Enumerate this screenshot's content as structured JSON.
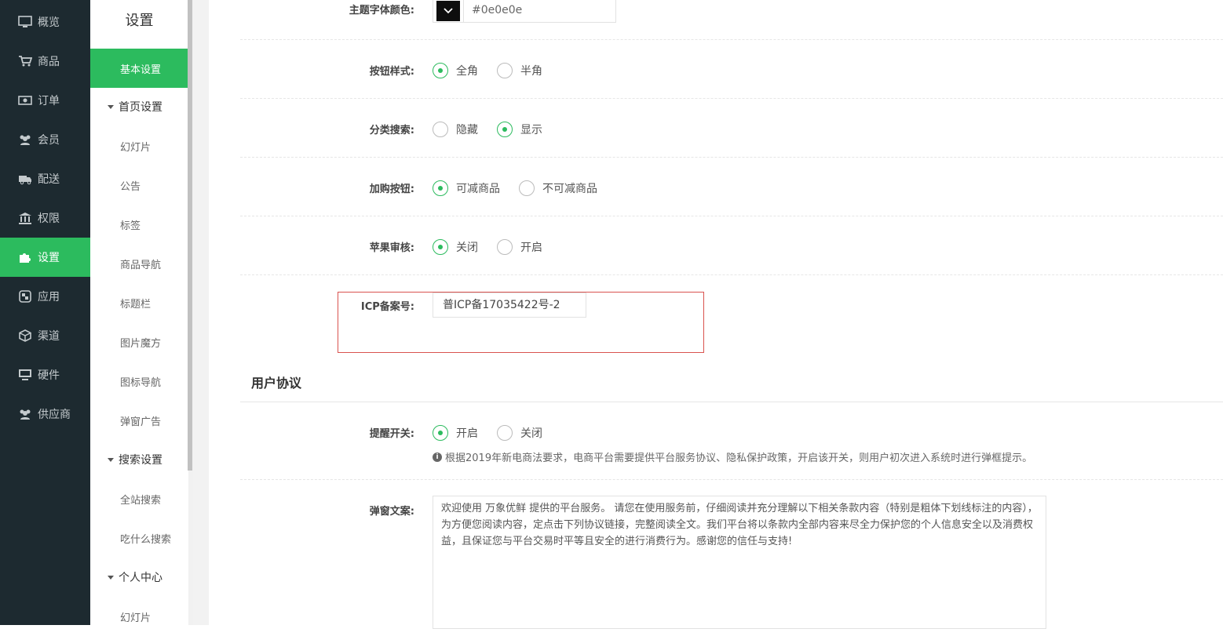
{
  "nav": {
    "items": [
      {
        "label": "概览",
        "icon": "monitor-icon"
      },
      {
        "label": "商品",
        "icon": "cart-icon"
      },
      {
        "label": "订单",
        "icon": "money-icon"
      },
      {
        "label": "会员",
        "icon": "users-icon"
      },
      {
        "label": "配送",
        "icon": "truck-icon"
      },
      {
        "label": "权限",
        "icon": "bank-icon"
      },
      {
        "label": "设置",
        "icon": "puzzle-icon",
        "active": true
      },
      {
        "label": "应用",
        "icon": "apps-icon"
      },
      {
        "label": "渠道",
        "icon": "cube-icon"
      },
      {
        "label": "硬件",
        "icon": "desktop-icon"
      },
      {
        "label": "供应商",
        "icon": "supplier-icon"
      }
    ]
  },
  "sub": {
    "title": "设置",
    "basic": "基本设置",
    "home_group": "首页设置",
    "home_items": [
      "幻灯片",
      "公告",
      "标签",
      "商品导航",
      "标题栏",
      "图片魔方",
      "图标导航",
      "弹窗广告"
    ],
    "search_group": "搜索设置",
    "search_items": [
      "全站搜索",
      "吃什么搜索"
    ],
    "personal_group": "个人中心",
    "personal_items": [
      "幻灯片"
    ]
  },
  "form": {
    "theme_font_color_label": "主题字体颜色:",
    "theme_font_color_value": "#0e0e0e",
    "button_style_label": "按钮样式:",
    "button_style_opts": [
      "全角",
      "半角"
    ],
    "category_search_label": "分类搜索:",
    "category_search_opts": [
      "隐藏",
      "显示"
    ],
    "add_cart_label": "加购按钮:",
    "add_cart_opts": [
      "可减商品",
      "不可减商品"
    ],
    "apple_review_label": "苹果审核:",
    "apple_review_opts": [
      "关闭",
      "开启"
    ],
    "icp_label": "ICP备案号:",
    "icp_value": "普ICP备17035422号-2"
  },
  "agreement": {
    "title": "用户协议",
    "remind_label": "提醒开关:",
    "remind_opts": [
      "开启",
      "关闭"
    ],
    "hint": "根据2019年新电商法要求，电商平台需要提供平台服务协议、隐私保护政策，开启该开关，则用户初次进入系统时进行弹框提示。",
    "popup_label": "弹窗文案:",
    "popup_text": "欢迎使用 万象优鲜 提供的平台服务。 请您在使用服务前，仔细阅读并充分理解以下相关条款内容（特别是粗体下划线标注的内容），为方便您阅读内容，定点击下列协议链接，完整阅读全文。我们平台将以条款内全部内容来尽全力保护您的个人信息安全以及消费权益，且保证您与平台交易时平等且安全的进行消费行为。感谢您的信任与支持!"
  },
  "colors": {
    "accent": "#2cbb5e",
    "nav_bg": "#1d2a30",
    "highlight_border": "#d9534f"
  }
}
